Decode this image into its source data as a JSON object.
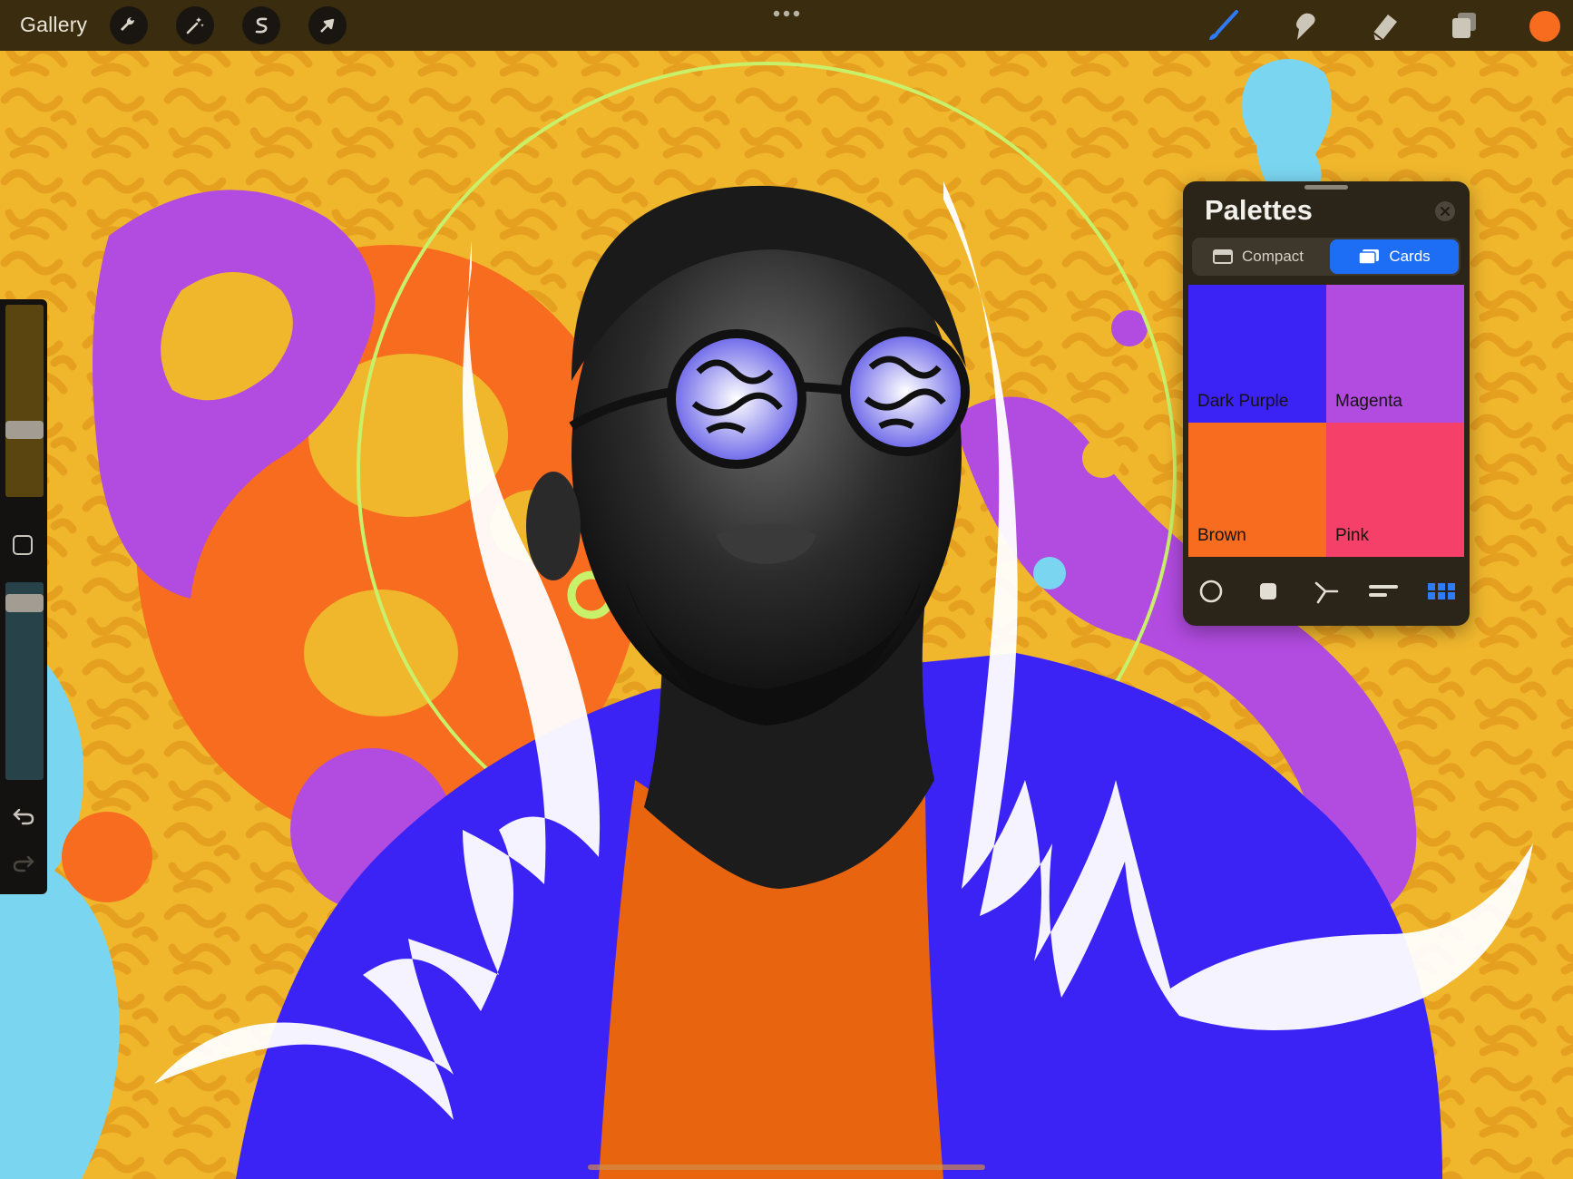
{
  "toolbar": {
    "gallery_label": "Gallery",
    "left_tools": [
      "wrench-icon",
      "magic-wand-icon",
      "selection-s-icon",
      "transform-arrow-icon"
    ],
    "right_tools": [
      "brush-icon",
      "smudge-icon",
      "eraser-icon",
      "layers-icon"
    ],
    "current_color": "#f86c1f",
    "accent_color": "#1e6ef5"
  },
  "sidebar": {
    "brush_size_level": 0.62,
    "opacity_level": 0.94,
    "icons": [
      "modify-square-icon",
      "undo-icon",
      "redo-icon"
    ]
  },
  "palettes": {
    "title": "Palettes",
    "view_modes": [
      {
        "label": "Compact",
        "selected": false
      },
      {
        "label": "Cards",
        "selected": true
      }
    ],
    "swatches": [
      {
        "name": "Dark Purple",
        "color": "#3b22f5"
      },
      {
        "name": "Magenta",
        "color": "#b24be0"
      },
      {
        "name": "Brown",
        "color": "#f86c1f"
      },
      {
        "name": "Pink",
        "color": "#f5416a"
      }
    ],
    "footer_tabs": [
      "disc-icon",
      "classic-square-icon",
      "harmony-icon",
      "value-sliders-icon",
      "palettes-grid-icon"
    ]
  },
  "artwork": {
    "colors": {
      "background": "#f0b72d",
      "pattern": "#e59d1f",
      "orange": "#f86c1f",
      "purple": "#b24be0",
      "blue": "#3b22f5",
      "cyan": "#7ad6f0",
      "lime": "#c8f06a",
      "white": "#ffffff",
      "shirt": "#e8640f",
      "skin_dark": "#1c1c1c",
      "skin_mid": "#555555"
    }
  }
}
